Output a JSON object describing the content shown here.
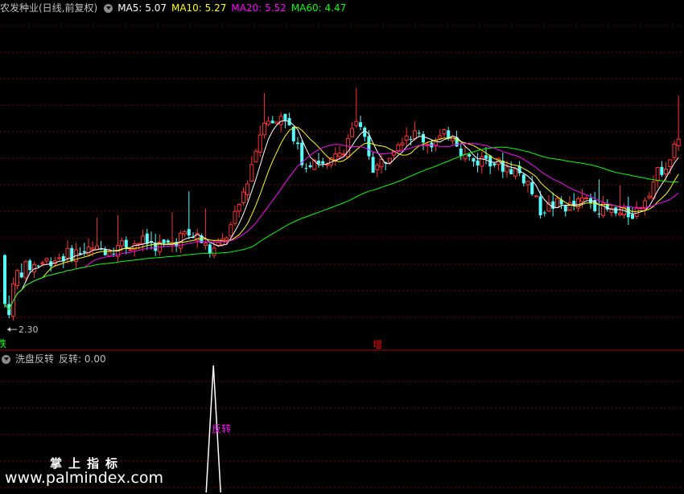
{
  "legend": {
    "stock_name": "农发种业(日线,前复权)",
    "ma": [
      {
        "label": "MA5: 5.07",
        "color": "#ffffff"
      },
      {
        "label": "MA10: 5.27",
        "color": "#ffff00"
      },
      {
        "label": "MA20: 5.52",
        "color": "#ff00ff"
      },
      {
        "label": "MA60: 4.47",
        "color": "#00ff00"
      }
    ]
  },
  "sub_legend": {
    "indicator_name": "洗盘反转",
    "value_label": "反转: 0.00"
  },
  "markers": {
    "low_price_label": "2.30",
    "left_label": "跌",
    "increase_label": "增",
    "reversal_label": "反转"
  },
  "watermark": {
    "title": "掌上指标",
    "url": "www.palmindex.com"
  },
  "colors": {
    "up": "#ff3232",
    "down": "#54ffff",
    "grid": "#800000",
    "divider": "#b00000",
    "ma5": "#ffffff",
    "ma10": "#ffff00",
    "ma20": "#ff00ff",
    "ma60": "#00ff00",
    "reversal": "#ffffff",
    "reversal_label": "#ff00ff",
    "increase_label": "#ff0000",
    "left_label": "#00ff00"
  },
  "chart_data": {
    "type": "candlestick",
    "main_panel": {
      "price_range": [
        2.0,
        8.2
      ],
      "low_marker_price": 2.3,
      "grid": true,
      "ma_series": [
        {
          "name": "MA5",
          "value": 5.07
        },
        {
          "name": "MA10",
          "value": 5.27
        },
        {
          "name": "MA20",
          "value": 5.52
        },
        {
          "name": "MA60",
          "value": 4.47
        }
      ]
    },
    "sub_panel": {
      "indicator": "洗盘反转",
      "series": "反转",
      "current_value": 0.0,
      "range": [
        0,
        1
      ],
      "spike_positions": [
        0.312
      ]
    }
  }
}
